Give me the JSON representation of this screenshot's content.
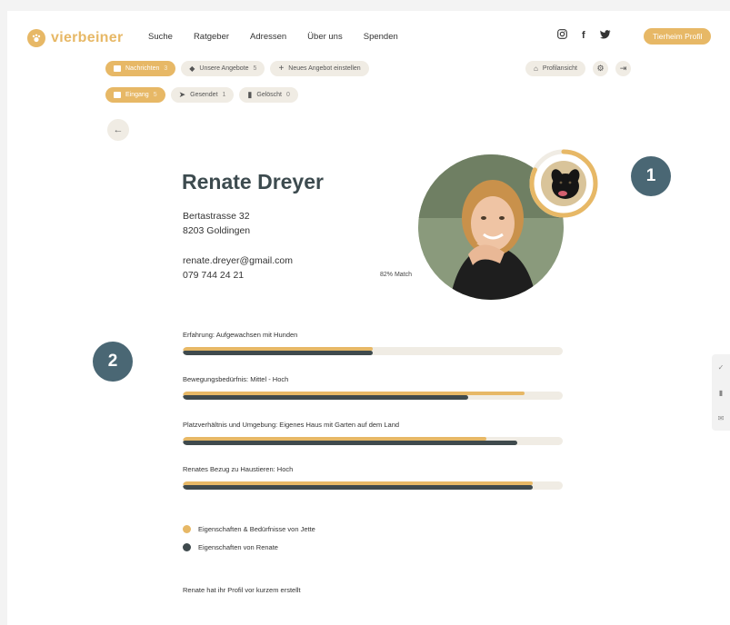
{
  "brand": {
    "name": "vierbeiner",
    "color": "#e7b866",
    "dark": "#3f4a4d",
    "badge_color": "#4a6774"
  },
  "nav": [
    "Suche",
    "Ratgeber",
    "Adressen",
    "Über uns",
    "Spenden"
  ],
  "social": {
    "instagram": "instagram-icon",
    "facebook": "f",
    "twitter": "twitter-icon"
  },
  "header": {
    "profile_button": "Tierheim Profil"
  },
  "tabs_row1": [
    {
      "label": "Nachrichten",
      "count": "3",
      "active": true
    },
    {
      "label": "Unsere Angebote",
      "count": "5",
      "active": false
    },
    {
      "label": "Neues Angebot einstellen",
      "count": "",
      "active": false
    }
  ],
  "profile_view": {
    "label": "Profilansicht"
  },
  "tabs_row2": [
    {
      "label": "Eingang",
      "count": "5",
      "active": true
    },
    {
      "label": "Gesendet",
      "count": "1",
      "active": false
    },
    {
      "label": "Gelöscht",
      "count": "0",
      "active": false
    }
  ],
  "profile": {
    "name": "Renate Dreyer",
    "street": "Bertastrasse 32",
    "city": "8203 Goldingen",
    "email": "renate.dreyer@gmail.com",
    "phone": "079 744 24 21",
    "match": "82% Match",
    "match_value": 0.82
  },
  "badges": {
    "one": "1",
    "two": "2"
  },
  "attributes": [
    {
      "label": "Erfahrung: Aufgewachsen mit Hunden",
      "jette": 0.5,
      "renate": 0.5
    },
    {
      "label": "Bewegungsbedürfnis: Mittel - Hoch",
      "jette": 0.9,
      "renate": 0.75
    },
    {
      "label": "Platzverhältnis und Umgebung: Eigenes Haus mit Garten auf dem Land",
      "jette": 0.8,
      "renate": 0.88
    },
    {
      "label": "Renates Bezug zu Haustieren: Hoch",
      "jette": 0.92,
      "renate": 0.92
    }
  ],
  "legend": {
    "jette": "Eigenschaften & Bedürfnisse von Jette",
    "renate": "Eigenschaften von Renate"
  },
  "footer_note": "Renate hat ihr Profil vor kurzem erstellt"
}
